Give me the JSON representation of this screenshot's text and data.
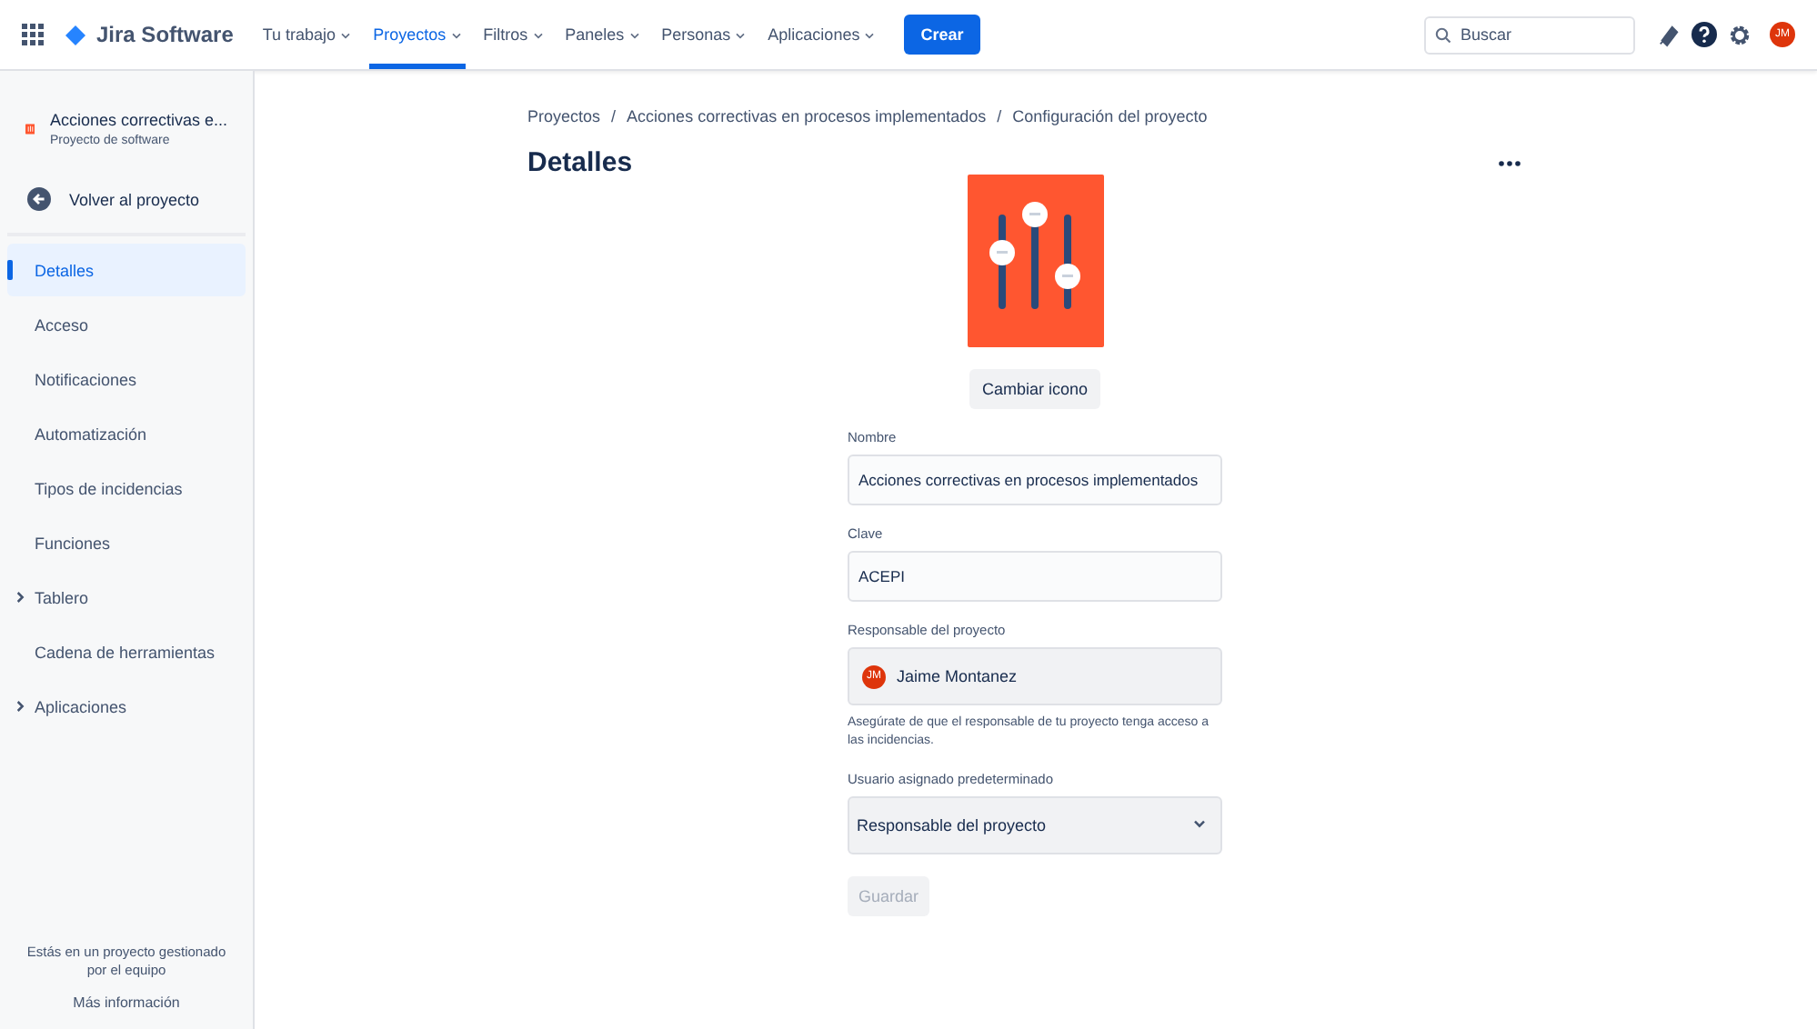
{
  "topbar": {
    "product": "Jira Software",
    "nav": [
      {
        "label": "Tu trabajo",
        "selected": false
      },
      {
        "label": "Proyectos",
        "selected": true
      },
      {
        "label": "Filtros",
        "selected": false
      },
      {
        "label": "Paneles",
        "selected": false
      },
      {
        "label": "Personas",
        "selected": false
      },
      {
        "label": "Aplicaciones",
        "selected": false
      }
    ],
    "create": "Crear",
    "search": {
      "placeholder": "Buscar"
    },
    "avatar": "JM"
  },
  "sidebar": {
    "project": {
      "name": "Acciones correctivas e...",
      "type": "Proyecto de software"
    },
    "back": "Volver al proyecto",
    "items": [
      {
        "label": "Detalles",
        "selected": true,
        "expandable": false
      },
      {
        "label": "Acceso",
        "selected": false,
        "expandable": false
      },
      {
        "label": "Notificaciones",
        "selected": false,
        "expandable": false
      },
      {
        "label": "Automatización",
        "selected": false,
        "expandable": false
      },
      {
        "label": "Tipos de incidencias",
        "selected": false,
        "expandable": false
      },
      {
        "label": "Funciones",
        "selected": false,
        "expandable": false
      },
      {
        "label": "Tablero",
        "selected": false,
        "expandable": true
      },
      {
        "label": "Cadena de herramientas",
        "selected": false,
        "expandable": false
      },
      {
        "label": "Aplicaciones",
        "selected": false,
        "expandable": true
      }
    ],
    "footer": "Estás en un proyecto gestionado por el equipo",
    "more": "Más información"
  },
  "breadcrumbs": [
    "Proyectos",
    "Acciones correctivas en procesos implementados",
    "Configuración del proyecto"
  ],
  "breadcrumb_separator": "/",
  "title": "Detalles",
  "change_icon": "Cambiar icono",
  "fields": [
    {
      "kind": "text",
      "label": "Nombre",
      "value": "Acciones correctivas en procesos implementados"
    },
    {
      "kind": "text",
      "label": "Clave",
      "value": "ACEPI"
    },
    {
      "kind": "user",
      "label": "Responsable del proyecto",
      "value": "Jaime Montanez",
      "avatar": "JM",
      "help": "Asegúrate de que el responsable de tu proyecto tenga acceso a las incidencias."
    },
    {
      "kind": "select",
      "label": "Usuario asignado predeterminado",
      "value": "Responsable del proyecto"
    }
  ],
  "save": {
    "label": "Guardar",
    "disabled": true
  }
}
